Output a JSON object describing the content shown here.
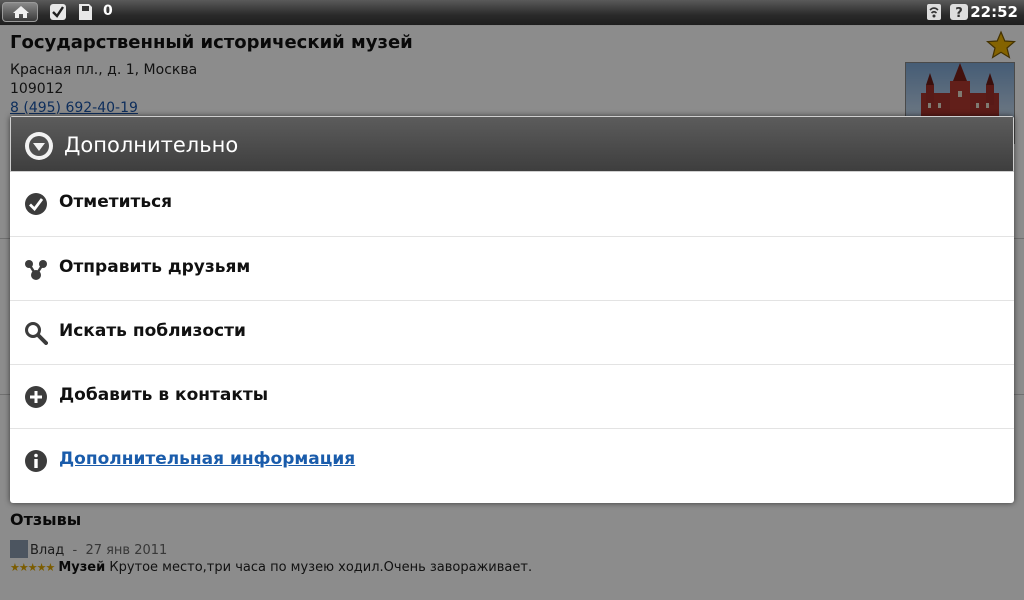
{
  "status_bar": {
    "notification_count": "0",
    "time": "22:52",
    "icons": [
      "home-icon",
      "check-icon",
      "sd-card-icon",
      "wifi-icon",
      "help-icon"
    ]
  },
  "place": {
    "name": "Государственный исторический музей",
    "address_line": "Красная пл., д. 1, Москва",
    "postal_code": "109012",
    "phone": "8 (495) 692-40-19"
  },
  "reviews": {
    "heading": "Отзывы",
    "items": [
      {
        "author": "Влад",
        "separator": "-",
        "date": "27 янв 2011",
        "rating": 5,
        "stars": "★★★★★",
        "title": "Музей",
        "text": "Крутое место,три часа по музею ходил.Очень завораживает."
      }
    ]
  },
  "dialog": {
    "title": "Дополнительно",
    "items": [
      {
        "label": "Отметиться",
        "icon": "check-circle-icon"
      },
      {
        "label": "Отправить друзьям",
        "icon": "share-friends-icon"
      },
      {
        "label": "Искать поблизости",
        "icon": "search-icon"
      },
      {
        "label": "Добавить в контакты",
        "icon": "add-circle-icon"
      },
      {
        "label": "Дополнительная информация",
        "icon": "info-icon"
      }
    ]
  },
  "colors": {
    "dialog_header": "#4a4a4a",
    "link": "#1a5cab",
    "star": "#f0b400"
  }
}
